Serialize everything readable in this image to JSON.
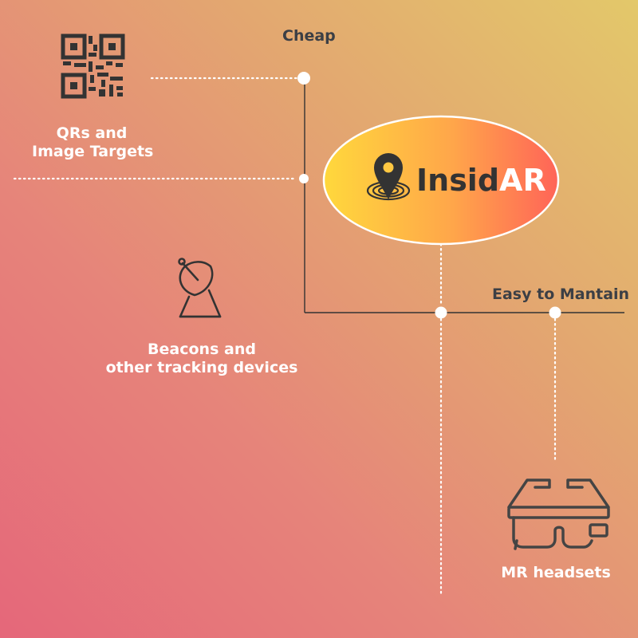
{
  "axes": {
    "y_label": "Cheap",
    "x_label": "Easy to Mantain"
  },
  "logo": {
    "name_part1": "Insid",
    "name_part2": "AR",
    "color_part1": "#333333",
    "color_part2": "#ffffff",
    "icon": "map-pin-icon"
  },
  "items": [
    {
      "label_line1": "QRs and",
      "label_line2": "Image Targets",
      "icon": "qr-code-icon"
    },
    {
      "label_line1": "Beacons and",
      "label_line2": "other tracking devices",
      "icon": "satellite-dish-icon"
    },
    {
      "label_line1": "MR headsets",
      "icon": "mr-headset-icon"
    }
  ],
  "colors": {
    "background_from": "#e5677a",
    "background_to": "#e3c86a",
    "ellipse_from": "#ffd83c",
    "ellipse_to": "#ff6458",
    "line": "#333333",
    "dot": "#ffffff"
  }
}
